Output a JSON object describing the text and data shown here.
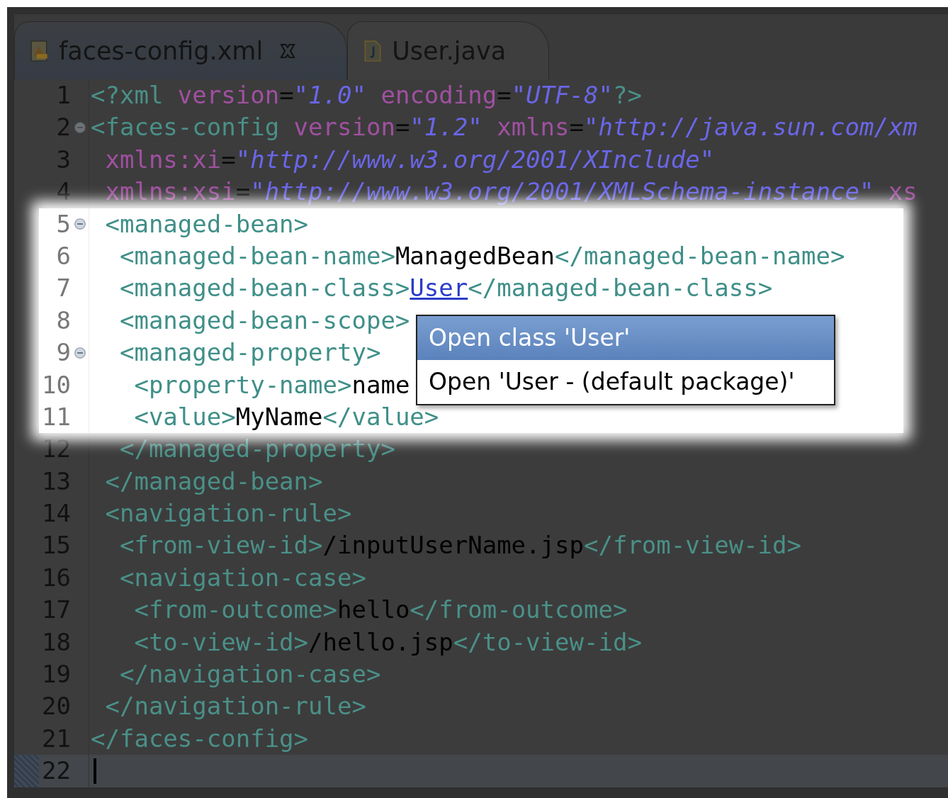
{
  "tabs": [
    {
      "label": "faces-config.xml",
      "kind": "xml",
      "selected": true
    },
    {
      "label": "User.java",
      "kind": "java",
      "selected": false
    }
  ],
  "editor": {
    "lines": [
      {
        "number": "1",
        "foldable": false,
        "highlighted": false,
        "current": false,
        "tokens": [
          {
            "kind": "tag",
            "text": "<?xml"
          },
          {
            "kind": "attr",
            "text": " version"
          },
          {
            "kind": "punct",
            "text": "="
          },
          {
            "kind": "value",
            "text": "\"1.0\""
          },
          {
            "kind": "attr",
            "text": " encoding"
          },
          {
            "kind": "punct",
            "text": "="
          },
          {
            "kind": "value",
            "text": "\"UTF-8\""
          },
          {
            "kind": "tag",
            "text": "?>"
          }
        ]
      },
      {
        "number": "2",
        "foldable": true,
        "highlighted": false,
        "current": false,
        "tokens": [
          {
            "kind": "tag",
            "text": "<faces-config"
          },
          {
            "kind": "attr",
            "text": " version"
          },
          {
            "kind": "punct",
            "text": "="
          },
          {
            "kind": "value",
            "text": "\"1.2\""
          },
          {
            "kind": "attr",
            "text": " xmlns"
          },
          {
            "kind": "punct",
            "text": "="
          },
          {
            "kind": "value",
            "text": "\"http://java.sun.com/xm"
          }
        ]
      },
      {
        "number": "3",
        "foldable": false,
        "highlighted": false,
        "current": false,
        "tokens": [
          {
            "kind": "attr",
            "text": " xmlns:xi"
          },
          {
            "kind": "punct",
            "text": "="
          },
          {
            "kind": "value",
            "text": "\"http://www.w3.org/2001/XInclude\""
          }
        ]
      },
      {
        "number": "4",
        "foldable": false,
        "highlighted": false,
        "current": false,
        "tokens": [
          {
            "kind": "attr",
            "text": " xmlns:xsi"
          },
          {
            "kind": "punct",
            "text": "="
          },
          {
            "kind": "value",
            "text": "\"http://www.w3.org/2001/XMLSchema-instance\""
          },
          {
            "kind": "attr",
            "text": " xs"
          }
        ]
      },
      {
        "number": "5",
        "foldable": true,
        "highlighted": true,
        "current": false,
        "tokens": [
          {
            "kind": "tag",
            "text": " <managed-bean>"
          }
        ]
      },
      {
        "number": "6",
        "foldable": false,
        "highlighted": true,
        "current": false,
        "tokens": [
          {
            "kind": "tag",
            "text": "  <managed-bean-name>"
          },
          {
            "kind": "text",
            "text": "ManagedBean"
          },
          {
            "kind": "tag",
            "text": "</managed-bean-name>"
          }
        ]
      },
      {
        "number": "7",
        "foldable": false,
        "highlighted": true,
        "current": false,
        "tokens": [
          {
            "kind": "tag",
            "text": "  <managed-bean-class>"
          },
          {
            "kind": "link",
            "text": "User"
          },
          {
            "kind": "tag",
            "text": "</managed-bean-class>"
          }
        ]
      },
      {
        "number": "8",
        "foldable": false,
        "highlighted": true,
        "current": false,
        "tokens": [
          {
            "kind": "tag",
            "text": "  <managed-bean-scope>"
          }
        ]
      },
      {
        "number": "9",
        "foldable": true,
        "highlighted": true,
        "current": false,
        "tokens": [
          {
            "kind": "tag",
            "text": "  <managed-property>"
          }
        ]
      },
      {
        "number": "10",
        "foldable": false,
        "highlighted": true,
        "current": false,
        "tokens": [
          {
            "kind": "tag",
            "text": "   <property-name>"
          },
          {
            "kind": "text",
            "text": "name"
          }
        ]
      },
      {
        "number": "11",
        "foldable": false,
        "highlighted": true,
        "current": false,
        "tokens": [
          {
            "kind": "tag",
            "text": "   <value>"
          },
          {
            "kind": "text",
            "text": "MyName"
          },
          {
            "kind": "tag",
            "text": "</value>"
          }
        ]
      },
      {
        "number": "12",
        "foldable": false,
        "highlighted": false,
        "current": false,
        "tokens": [
          {
            "kind": "tag",
            "text": "  </managed-property>"
          }
        ]
      },
      {
        "number": "13",
        "foldable": false,
        "highlighted": false,
        "current": false,
        "tokens": [
          {
            "kind": "tag",
            "text": " </managed-bean>"
          }
        ]
      },
      {
        "number": "14",
        "foldable": false,
        "highlighted": false,
        "current": false,
        "tokens": [
          {
            "kind": "tag",
            "text": " <navigation-rule>"
          }
        ]
      },
      {
        "number": "15",
        "foldable": false,
        "highlighted": false,
        "current": false,
        "tokens": [
          {
            "kind": "tag",
            "text": "  <from-view-id>"
          },
          {
            "kind": "text",
            "text": "/inputUserName.jsp"
          },
          {
            "kind": "tag",
            "text": "</from-view-id>"
          }
        ]
      },
      {
        "number": "16",
        "foldable": false,
        "highlighted": false,
        "current": false,
        "tokens": [
          {
            "kind": "tag",
            "text": "  <navigation-case>"
          }
        ]
      },
      {
        "number": "17",
        "foldable": false,
        "highlighted": false,
        "current": false,
        "tokens": [
          {
            "kind": "tag",
            "text": "   <from-outcome>"
          },
          {
            "kind": "text",
            "text": "hello"
          },
          {
            "kind": "tag",
            "text": "</from-outcome>"
          }
        ]
      },
      {
        "number": "18",
        "foldable": false,
        "highlighted": false,
        "current": false,
        "tokens": [
          {
            "kind": "tag",
            "text": "   <to-view-id>"
          },
          {
            "kind": "text",
            "text": "/hello.jsp"
          },
          {
            "kind": "tag",
            "text": "</to-view-id>"
          }
        ]
      },
      {
        "number": "19",
        "foldable": false,
        "highlighted": false,
        "current": false,
        "tokens": [
          {
            "kind": "tag",
            "text": "  </navigation-case>"
          }
        ]
      },
      {
        "number": "20",
        "foldable": false,
        "highlighted": false,
        "current": false,
        "tokens": [
          {
            "kind": "tag",
            "text": " </navigation-rule>"
          }
        ]
      },
      {
        "number": "21",
        "foldable": false,
        "highlighted": false,
        "current": false,
        "tokens": [
          {
            "kind": "tag",
            "text": "</faces-config>"
          }
        ]
      },
      {
        "number": "22",
        "foldable": false,
        "highlighted": false,
        "current": true
      }
    ]
  },
  "popup": {
    "items": [
      {
        "label": "Open class 'User'",
        "selected": true
      },
      {
        "label": "Open 'User - (default package)'",
        "selected": false
      }
    ]
  }
}
